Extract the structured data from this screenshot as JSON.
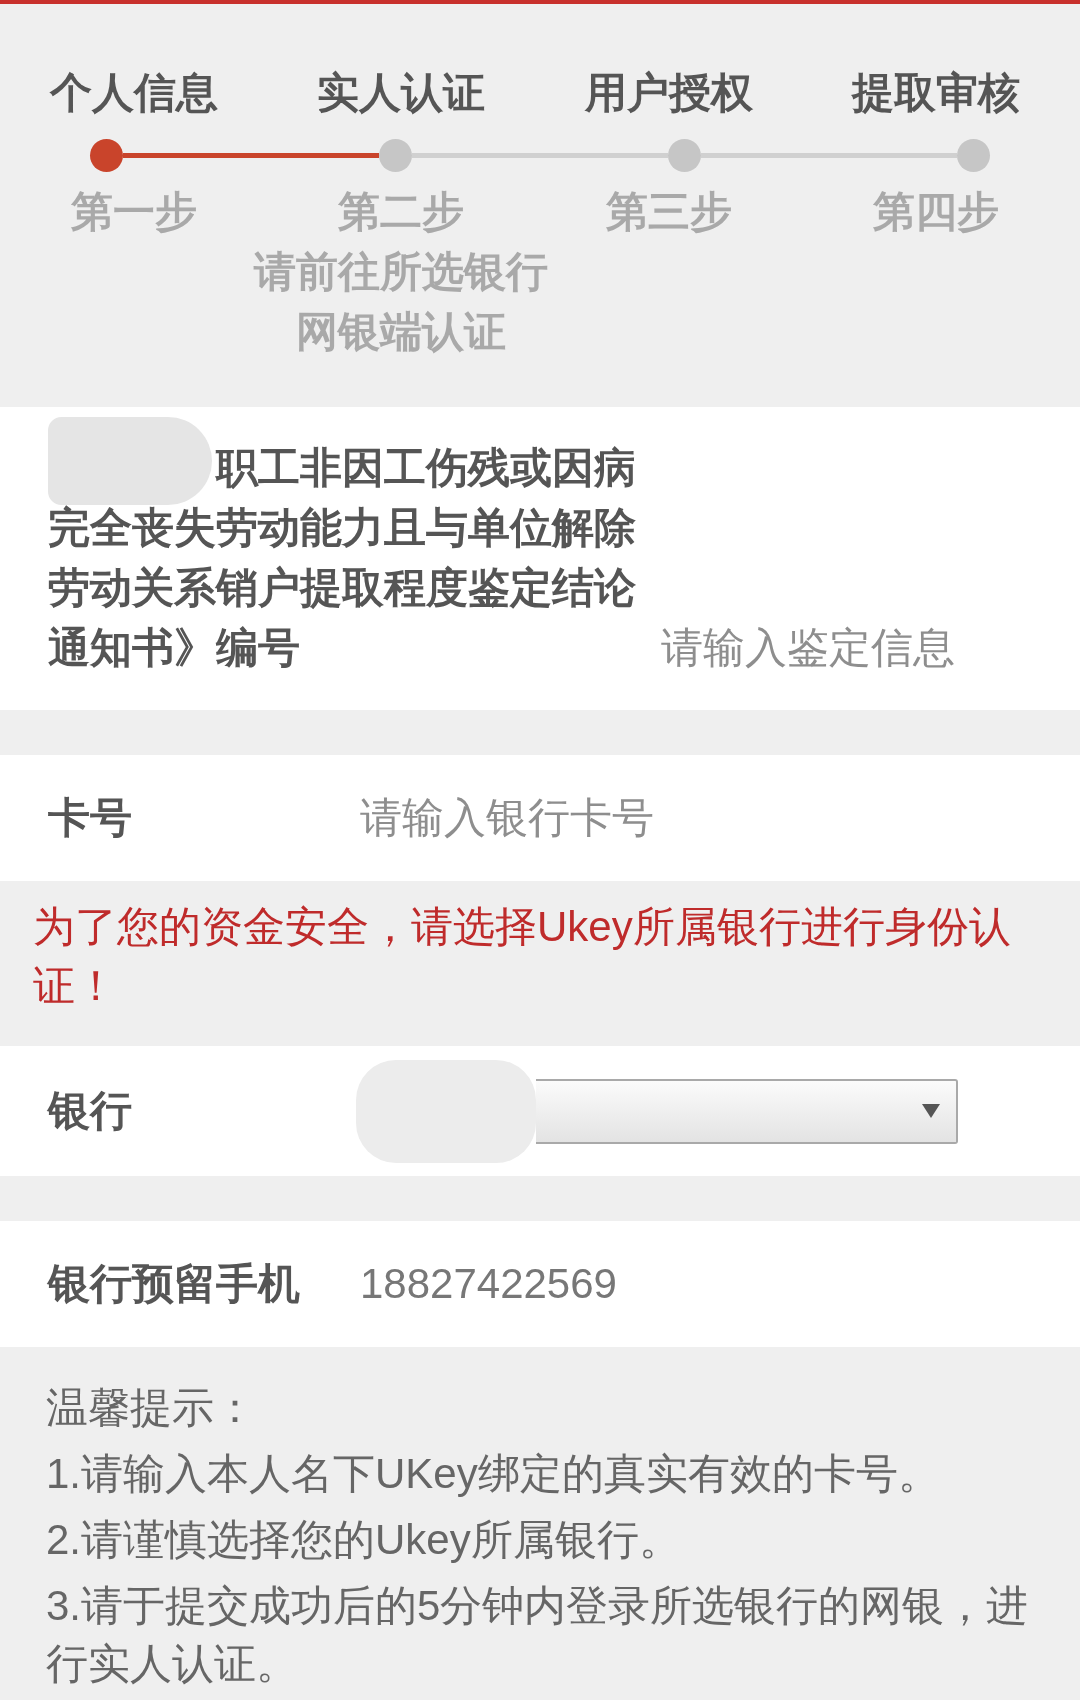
{
  "steps": [
    {
      "title": "个人信息",
      "label": "第一步",
      "active": true
    },
    {
      "title": "实人认证",
      "label": "第二步",
      "active": false,
      "note": "请前往所选银行网银端认证"
    },
    {
      "title": "用户授权",
      "label": "第三步",
      "active": false
    },
    {
      "title": "提取审核",
      "label": "第四步",
      "active": false
    }
  ],
  "assessment_field": {
    "label": "职工非因工伤残或因病完全丧失劳动能力且与单位解除劳动关系销户提取程度鉴定结论通知书》编号",
    "label_redacted": true,
    "placeholder": "请输入鉴定信息"
  },
  "card_number_field": {
    "label": "卡号",
    "placeholder": "请输入银行卡号"
  },
  "security_notice": "为了您的资金安全，请选择Ukey所属银行进行身份认证！",
  "bank_field": {
    "label": "银行",
    "redacted": true
  },
  "phone_field": {
    "label": "银行预留手机",
    "value": "18827422569"
  },
  "tips": {
    "title": "温馨提示：",
    "items": [
      "1.请输入本人名下UKey绑定的真实有效的卡号。",
      "2.请谨慎选择您的Ukey所属银行。",
      "3.请于提交成功后的5分钟内登录所选银行的网银，进行实人认证。"
    ]
  }
}
